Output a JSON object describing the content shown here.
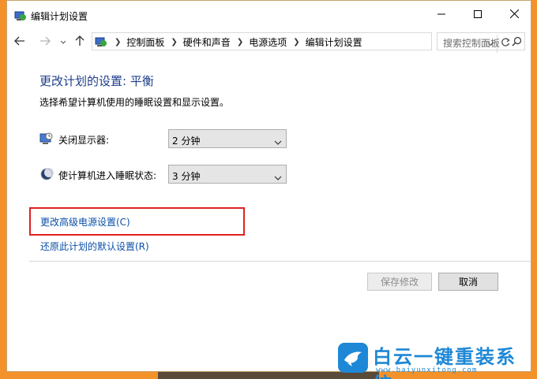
{
  "window": {
    "title": "编辑计划设置",
    "controls": {
      "minimize": "minimize-icon",
      "maximize": "maximize-icon",
      "close": "close-icon"
    }
  },
  "navigation": {
    "breadcrumbs": [
      "控制面板",
      "硬件和声音",
      "电源选项",
      "编辑计划设置"
    ],
    "search_placeholder": "搜索控制面板"
  },
  "content": {
    "heading": "更改计划的设置: 平衡",
    "description": "选择希望计算机使用的睡眠设置和显示设置。",
    "settings": [
      {
        "label": "关闭显示器:",
        "value": "2 分钟",
        "icon": "monitor-clock-icon"
      },
      {
        "label": "使计算机进入睡眠状态:",
        "value": "3 分钟",
        "icon": "moon-sleep-icon"
      }
    ],
    "links": {
      "advanced": "更改高级电源设置(C)",
      "restore": "还原此计划的默认设置(R)"
    },
    "buttons": {
      "save": "保存修改",
      "cancel": "取消"
    }
  },
  "watermark": {
    "title": "白云一键重装系统",
    "url": "www.baiyunxitong.com"
  },
  "colors": {
    "heading": "#1e3d8a",
    "link": "#0b4fa8",
    "highlight_box": "#e02020",
    "desktop": "#f3922a",
    "watermark": "#1e88d6"
  }
}
